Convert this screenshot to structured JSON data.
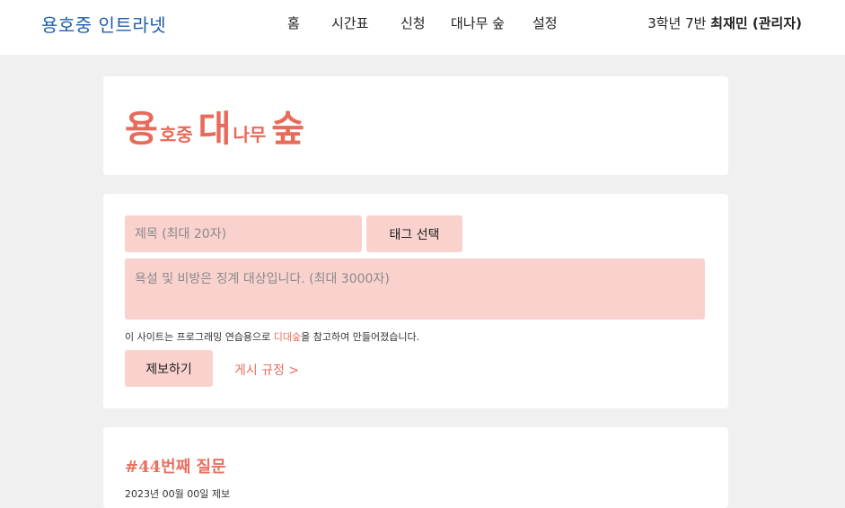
{
  "header": {
    "brand": "용호중 인트라넷",
    "nav": [
      {
        "label": "홈"
      },
      {
        "label": "시간표"
      },
      {
        "label": "신청"
      },
      {
        "label": "대나무 숲"
      },
      {
        "label": "설정"
      }
    ],
    "user": {
      "class_label": "3학년 7반",
      "name_role": "최재민 (관리자)"
    }
  },
  "logo": {
    "char1": "용",
    "part1": "호중",
    "char2": "대",
    "part2": "나무",
    "char3": "숲"
  },
  "form": {
    "title_placeholder": "제목 (최대 20자)",
    "tag_button_label": "태그 선택",
    "body_placeholder": "욕설 및 비방은 징계 대상입니다. (최대 3000자)",
    "notice_prefix": "이 사이트는 프로그래밍 연습용으로 ",
    "notice_link": "디대숲",
    "notice_suffix": "을 참고하여 만들어졌습니다.",
    "submit_label": "제보하기",
    "rules_link": "게시 규정 >"
  },
  "post": {
    "heading": "#44번째 질문",
    "meta": "2023년 00월 00일 제보"
  },
  "colors": {
    "accent": "#e8705f",
    "brand": "#1f5fa8",
    "input_bg": "#f9d2ce",
    "page_bg": "#f0f0f0"
  }
}
